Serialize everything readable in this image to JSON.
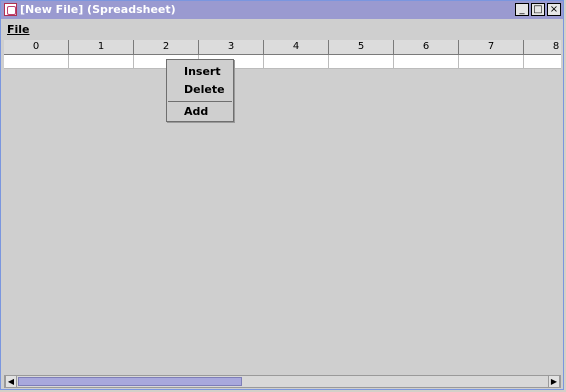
{
  "window": {
    "title": "[New File] (Spreadsheet)",
    "controls": {
      "minimize": "_",
      "maximize": "□",
      "close": "×"
    }
  },
  "menubar": {
    "file": "File"
  },
  "sheet": {
    "columns": [
      "0",
      "1",
      "2",
      "3",
      "4",
      "5",
      "6",
      "7",
      "8"
    ]
  },
  "context_menu": {
    "items": [
      {
        "label": "Insert"
      },
      {
        "label": "Delete"
      },
      {
        "label": "Add"
      }
    ]
  },
  "scrollbar": {
    "left_arrow": "◀",
    "right_arrow": "▶"
  },
  "colors": {
    "titlebar": "#9a9ad0",
    "sheet_bg": "#cfcfcf",
    "scroll_thumb": "#a8a8dc"
  }
}
